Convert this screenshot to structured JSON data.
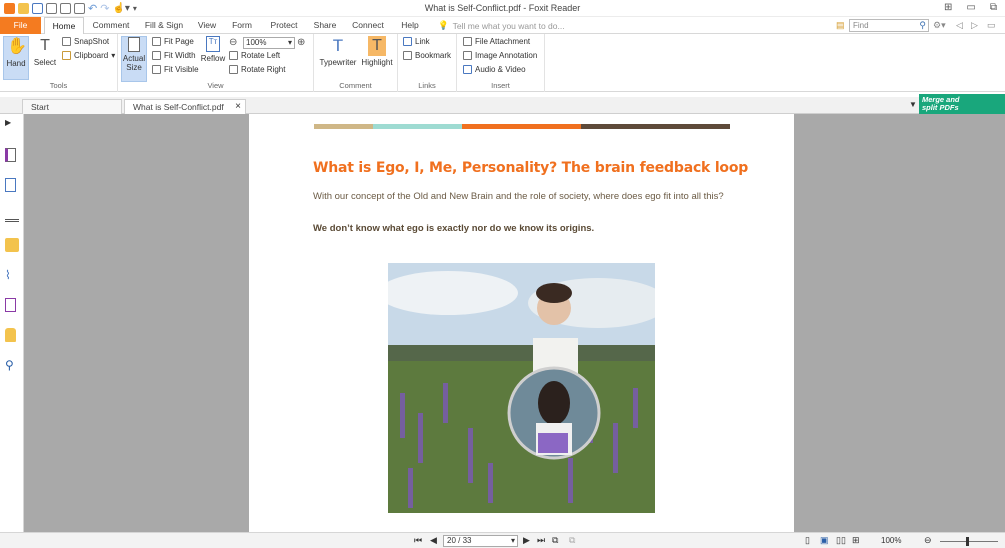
{
  "window": {
    "title": "What is Self-Conflict.pdf - Foxit Reader"
  },
  "menu_tabs": [
    "File",
    "Home",
    "Comment",
    "Fill & Sign",
    "View",
    "Form",
    "Protect",
    "Share",
    "Connect",
    "Help"
  ],
  "tell_me": "Tell me what you want to do...",
  "find": {
    "placeholder": "Find"
  },
  "ribbon": {
    "tools": {
      "label": "Tools",
      "hand": "Hand",
      "select": "Select",
      "snapshot": "SnapShot",
      "clipboard": "Clipboard"
    },
    "view": {
      "label": "View",
      "actual_size_1": "Actual",
      "actual_size_2": "Size",
      "fit_page": "Fit Page",
      "fit_width": "Fit Width",
      "fit_visible": "Fit Visible",
      "reflow": "Reflow",
      "zoom_value": "100%",
      "rotate_left": "Rotate Left",
      "rotate_right": "Rotate Right"
    },
    "comment": {
      "label": "Comment",
      "typewriter": "Typewriter",
      "highlight": "Highlight"
    },
    "links": {
      "label": "Links",
      "link": "Link",
      "bookmark": "Bookmark"
    },
    "insert": {
      "label": "Insert",
      "file_attachment": "File Attachment",
      "image_annotation": "Image Annotation",
      "audio_video": "Audio & Video"
    }
  },
  "doc_tabs": [
    {
      "label": "Start"
    },
    {
      "label": "What is Self-Conflict.pdf",
      "close": "×"
    }
  ],
  "banner": {
    "line1": "Merge and",
    "line2": "split PDFs"
  },
  "document": {
    "heading": "What is Ego, I, Me, Personality?  The brain feedback loop",
    "paragraph": "With our concept of the Old and New Brain and the role of society, where does ego fit into all this?",
    "bold_text": "We don’t know what ego is exactly nor do we know its origins.",
    "color_bar": [
      "#cfb787",
      "#9edbd2",
      "#f0701f",
      "#5e4a3a"
    ]
  },
  "status": {
    "page": "20 / 33",
    "zoom": "100%"
  },
  "colors": {
    "accent": "#f47b20",
    "heading": "#f0701f",
    "banner": "#19a77c"
  }
}
